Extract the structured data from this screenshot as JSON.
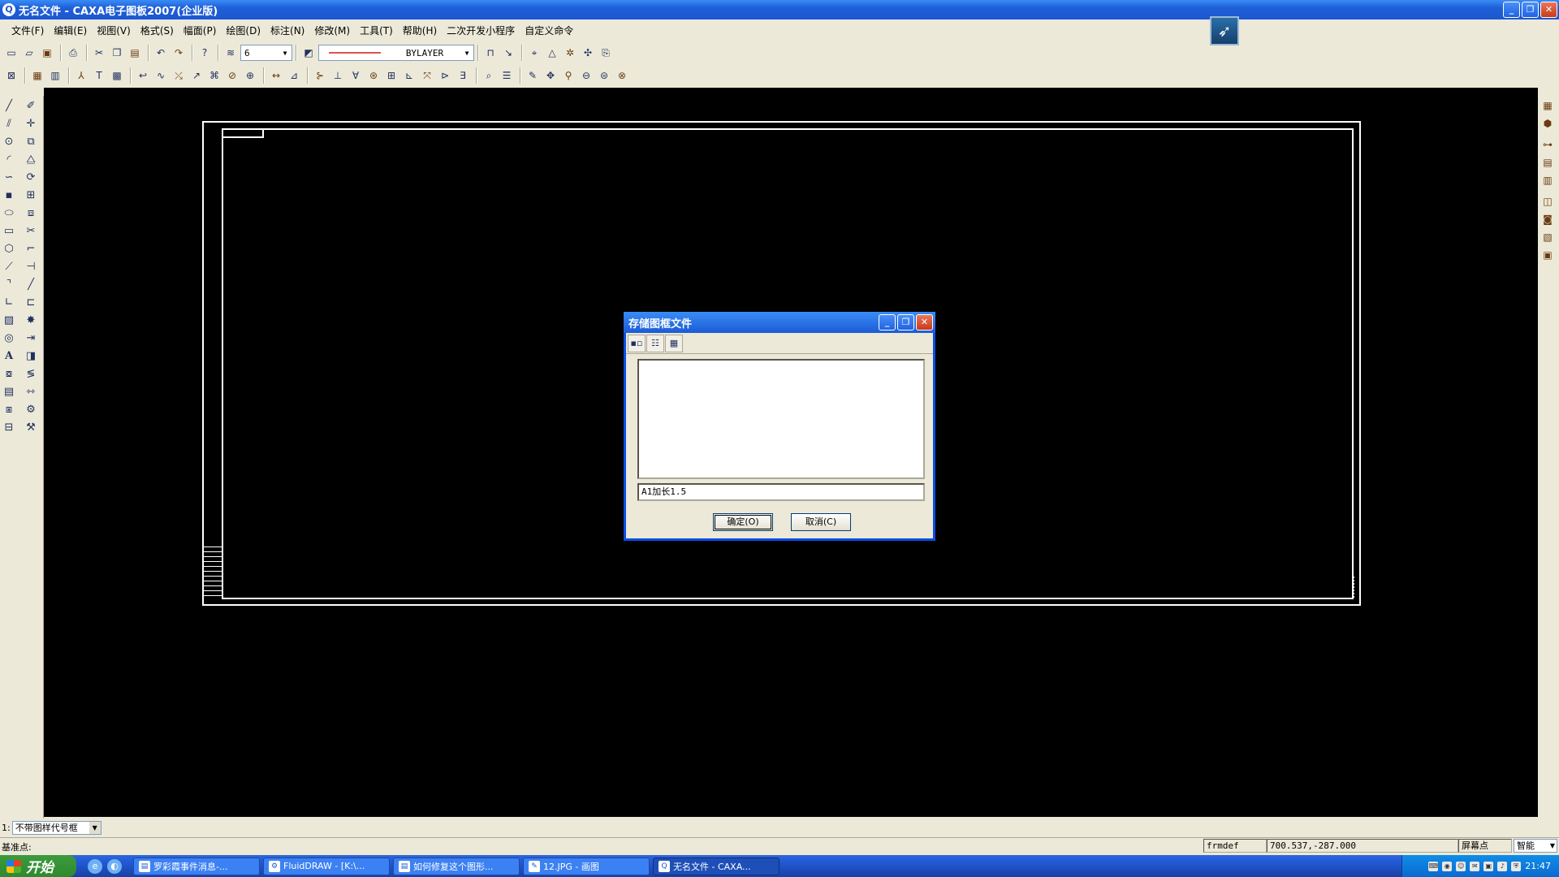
{
  "app": {
    "title": "无名文件 - CAXA电子图板2007(企业版)",
    "title_icon": "caxa-app-icon",
    "win_buttons": {
      "minimize": "_",
      "restore": "❐",
      "close": "✕"
    }
  },
  "menu": [
    "文件(F)",
    "编辑(E)",
    "视图(V)",
    "格式(S)",
    "幅面(P)",
    "绘图(D)",
    "标注(N)",
    "修改(M)",
    "工具(T)",
    "帮助(H)",
    "二次开发小程序",
    "自定义命令"
  ],
  "toolbar": {
    "layer_value": "6",
    "linetype_value": "BYLAYER",
    "accent_color": "#e05050"
  },
  "dialog": {
    "title": "存储图框文件",
    "filename_value": "A1加长1.5",
    "ok_label": "确定(O)",
    "cancel_label": "取消(C)",
    "tool_icons": [
      "large-icons-icon",
      "list-view-icon",
      "details-view-icon"
    ]
  },
  "command": {
    "prefix": "1:",
    "option": "不带图样代号框"
  },
  "status": {
    "prompt": "基准点:",
    "command_name": "frmdef",
    "coords": "700.537,-287.000",
    "snap_mode": "屏幕点",
    "snap_option": "智能"
  },
  "taskbar": {
    "start_label": "开始",
    "tasks": [
      "罗彩霞事件消息-...",
      "FluidDRAW - [K:\\...",
      "如何修复这个图形...",
      "12.JPG - 画图",
      "无名文件 - CAXA..."
    ],
    "clock": "21:47"
  },
  "colors": {
    "canvas_bg": "#000000",
    "frame_line": "#ffffff",
    "xp_blue": "#1c57d1"
  }
}
